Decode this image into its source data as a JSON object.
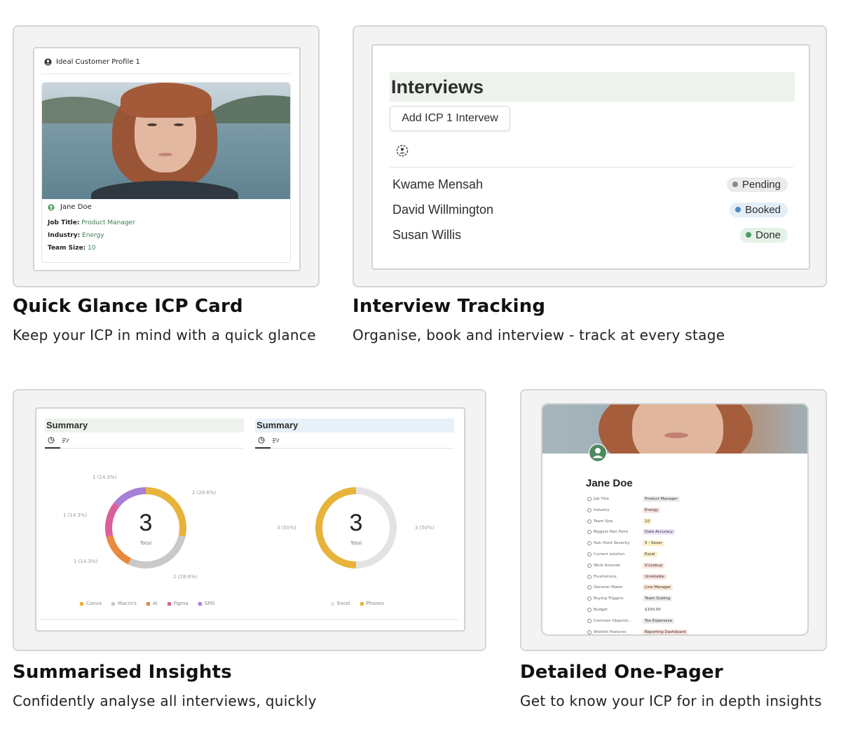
{
  "features": [
    {
      "title": "Quick Glance ICP Card",
      "desc": "Keep your ICP in mind with a quick glance"
    },
    {
      "title": "Interview Tracking",
      "desc": "Organise, book and interview - track at every stage"
    },
    {
      "title": "Summarised Insights",
      "desc": "Confidently analyse all interviews, quickly"
    },
    {
      "title": "Detailed One-Pager",
      "desc": "Get to know your ICP for in depth insights"
    }
  ],
  "icp_card": {
    "header": "Ideal Customer Profile 1",
    "name": "Jane Doe",
    "fields": [
      {
        "label": "Job Title:",
        "value": "Product Manager"
      },
      {
        "label": "Industry:",
        "value": "Energy"
      },
      {
        "label": "Team Size:",
        "value": "10"
      }
    ]
  },
  "interviews": {
    "heading": "Interviews",
    "add_button": "Add ICP 1 Intervew",
    "rows": [
      {
        "name": "Kwame Mensah",
        "status": "Pending",
        "bg": "#ebebea",
        "dot": "#8a8a8a"
      },
      {
        "name": "David Willmington",
        "status": "Booked",
        "bg": "#e3eef7",
        "dot": "#4a8bc2"
      },
      {
        "name": "Susan Willis",
        "status": "Done",
        "bg": "#e3f1e6",
        "dot": "#4f9d69"
      }
    ]
  },
  "summary": {
    "left": {
      "title": "Summary",
      "total": "3",
      "total_label": "Total",
      "labels": [
        "1 (14.3%)",
        "2 (28.6%)",
        "1 (14.3%)",
        "1 (14.3%)",
        "2 (28.6%)"
      ],
      "legend": [
        {
          "name": "Canva",
          "color": "#e8b33a"
        },
        {
          "name": "Macro's",
          "color": "#c9c9c9"
        },
        {
          "name": "AI",
          "color": "#e9893b"
        },
        {
          "name": "Figma",
          "color": "#d9609a"
        },
        {
          "name": "SMS",
          "color": "#a77fd6"
        }
      ]
    },
    "right": {
      "title": "Summary",
      "total": "3",
      "total_label": "Total",
      "labels": [
        "3 (50%)",
        "3 (50%)"
      ],
      "legend": [
        {
          "name": "Excel",
          "color": "#e3e3e3"
        },
        {
          "name": "Phones",
          "color": "#e8b33a"
        }
      ]
    }
  },
  "chart_data": [
    {
      "type": "pie",
      "title": "Summary",
      "categories": [
        "Canva",
        "Macro's",
        "AI",
        "Figma",
        "SMS"
      ],
      "values": [
        2,
        2,
        1,
        1,
        1
      ]
    },
    {
      "type": "pie",
      "title": "Summary",
      "categories": [
        "Excel",
        "Phones"
      ],
      "values": [
        3,
        3
      ]
    }
  ],
  "one_pager": {
    "name": "Jane Doe",
    "rows": [
      {
        "label": "Job Title",
        "value": "Product Manager",
        "bg": "#ececec"
      },
      {
        "label": "Industry",
        "value": "Energy",
        "bg": "#fbe3de"
      },
      {
        "label": "Team Size",
        "value": "10",
        "bg": "#fbf0c9"
      },
      {
        "label": "Biggest Pain Point",
        "value": "Data Accuracy",
        "bg": "#ece3f7"
      },
      {
        "label": "Pain Point Severity",
        "value": "5 - Sever",
        "bg": "#fbf0c9"
      },
      {
        "label": "Current solution",
        "value": "Excel",
        "bg": "#fbf0c9"
      },
      {
        "label": "Work Arounds",
        "value": "V-Lookup",
        "bg": "#fbe3de"
      },
      {
        "label": "Frustrations",
        "value": "Unreliable",
        "bg": "#fbe3de"
      },
      {
        "label": "Decision Maker",
        "value": "Line Manager",
        "bg": "#fbe8d6"
      },
      {
        "label": "Buying Triggers",
        "value": "Team Scaling",
        "bg": "#ececec"
      },
      {
        "label": "Budget",
        "value": "$150.00",
        "bg": "#ffffff"
      },
      {
        "label": "Common Objectio...",
        "value": "Too Expensive",
        "bg": "#ececec"
      },
      {
        "label": "Wishlist Features",
        "value": "Reporting Dashboard",
        "bg": "#fbe3de"
      }
    ]
  }
}
